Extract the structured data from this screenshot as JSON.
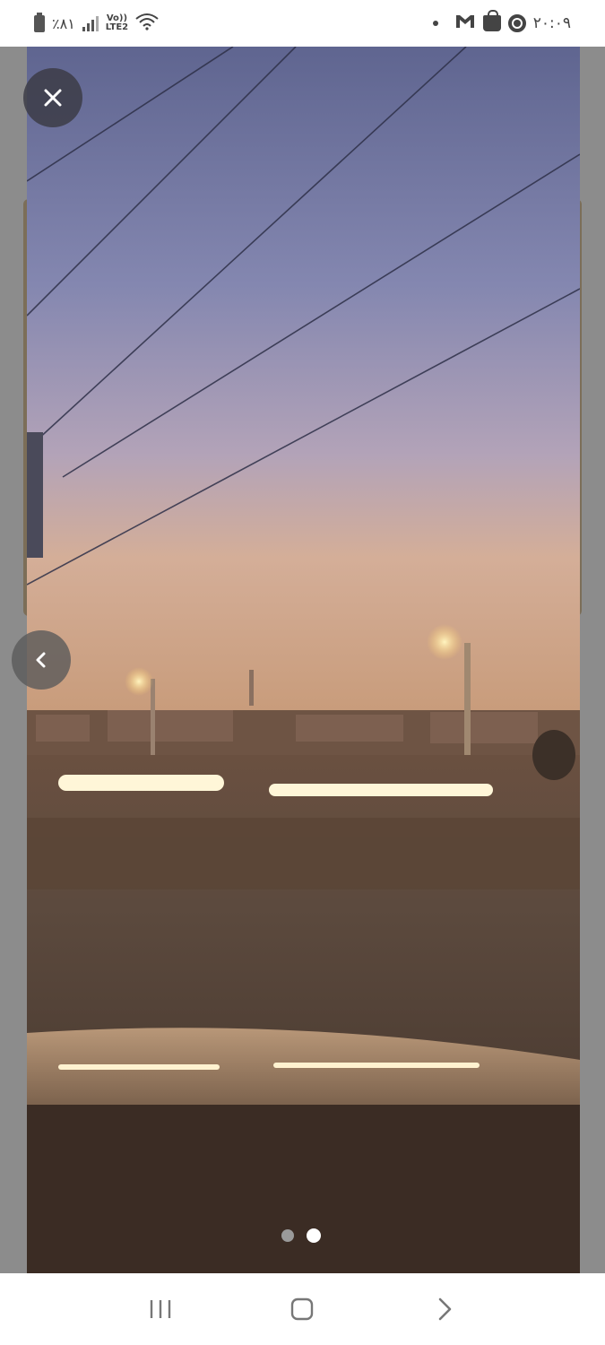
{
  "status_bar": {
    "battery_text": "٪٨١",
    "network_top": "Vo))",
    "network_bottom": "LTE2",
    "time": "٢٠:٠٩",
    "icons": [
      "battery-icon",
      "signal-icon",
      "wifi-icon",
      "gmail-icon",
      "shopping-bag-icon",
      "chrome-icon"
    ]
  },
  "viewer": {
    "close_icon": "close-icon",
    "prev_icon": "chevron-left-icon",
    "page_count": 2,
    "current_page": 2
  },
  "nav_bar": {
    "icons": [
      "recent-apps-icon",
      "home-icon",
      "back-icon"
    ]
  },
  "colors": {
    "sky_top": "#6f72a0",
    "sky_bottom": "#c9a890",
    "light_streak": "#fff6d8"
  }
}
